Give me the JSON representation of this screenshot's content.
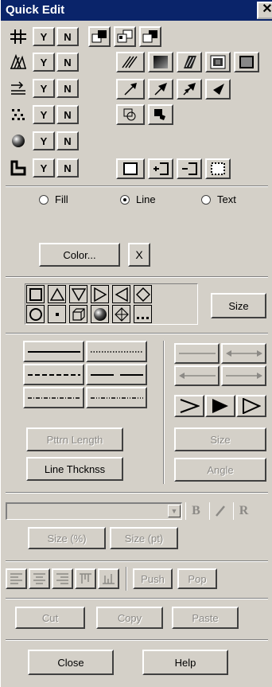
{
  "window": {
    "title": "Quick Edit",
    "close_glyph": "✕"
  },
  "toggle_rows": [
    {
      "icon": "grid-icon",
      "yes": "Y",
      "no": "N"
    },
    {
      "icon": "hatch-fill-icon",
      "yes": "Y",
      "no": "N"
    },
    {
      "icon": "arrow-line-icon",
      "yes": "Y",
      "no": "N"
    },
    {
      "icon": "snap-points-icon",
      "yes": "Y",
      "no": "N"
    },
    {
      "icon": "sphere-icon",
      "yes": "Y",
      "no": "N"
    },
    {
      "icon": "corner-icon",
      "yes": "Y",
      "no": "N"
    }
  ],
  "target": {
    "options": [
      "Fill",
      "Line",
      "Text"
    ],
    "selected": "Line"
  },
  "color": {
    "label": "Color...",
    "clear_glyph": "X"
  },
  "shapes": {
    "size_label": "Size"
  },
  "line_style": {
    "pattern_length": "Pttrn Length",
    "line_thickness": "Line Thcknss",
    "size": "Size",
    "angle": "Angle"
  },
  "text_format": {
    "font_value": "",
    "bold": "B",
    "italic": "I",
    "regular": "R",
    "size_pct": "Size (%)",
    "size_pt": "Size (pt)"
  },
  "alignment": {
    "push": "Push",
    "pop": "Pop"
  },
  "clipboard": {
    "cut": "Cut",
    "copy": "Copy",
    "paste": "Paste"
  },
  "footer": {
    "close": "Close",
    "help": "Help"
  },
  "colors": {
    "title_bar": "#0a246a",
    "face": "#d4d0c8",
    "disabled_text": "#8c8a86"
  }
}
